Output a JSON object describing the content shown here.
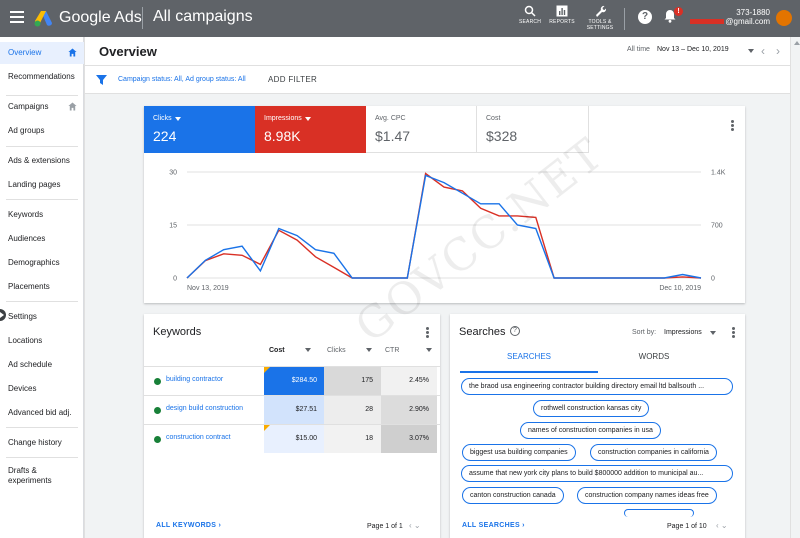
{
  "topbar": {
    "brand": "Google Ads",
    "title": "All campaigns",
    "tools": [
      {
        "label": "SEARCH",
        "icon": "search-icon"
      },
      {
        "label": "REPORTS",
        "icon": "reports-icon"
      },
      {
        "label1": "TOOLS &",
        "label2": "SETTINGS",
        "icon": "wrench-icon"
      }
    ],
    "notification_badge": "!",
    "account_number": "373-1880",
    "account_email": "@gmail.com"
  },
  "sidebar": {
    "items": [
      {
        "label": "Overview",
        "active": true
      },
      {
        "label": "Recommendations"
      },
      {
        "label": "Campaigns"
      },
      {
        "label": "Ad groups"
      },
      {
        "label": "Ads & extensions"
      },
      {
        "label": "Landing pages"
      },
      {
        "label": "Keywords"
      },
      {
        "label": "Audiences"
      },
      {
        "label": "Demographics"
      },
      {
        "label": "Placements"
      },
      {
        "label": "Settings"
      },
      {
        "label": "Locations"
      },
      {
        "label": "Ad schedule"
      },
      {
        "label": "Devices"
      },
      {
        "label": "Advanced bid adj."
      },
      {
        "label": "Change history"
      },
      {
        "label": "Drafts &"
      },
      {
        "label": "experiments"
      }
    ]
  },
  "header": {
    "title": "Overview",
    "date_label": "All time",
    "date_range": "Nov 13 – Dec 10, 2019"
  },
  "filter": {
    "status": "Campaign status: All, Ad group status: All",
    "add_filter": "ADD FILTER"
  },
  "metrics": [
    {
      "label": "Clicks",
      "value": "224",
      "color": "#1a73e8"
    },
    {
      "label": "Impressions",
      "value": "8.98K",
      "color": "#d93025"
    },
    {
      "label": "Avg. CPC",
      "value": "$1.47"
    },
    {
      "label": "Cost",
      "value": "$328"
    }
  ],
  "chart_data": {
    "type": "line",
    "x_start_label": "Nov 13, 2019",
    "x_end_label": "Dec 10, 2019",
    "left_axis_ticks": [
      "30",
      "15",
      "0"
    ],
    "right_axis_ticks": [
      "1.4K",
      "700",
      "0"
    ],
    "left_ylim": [
      0,
      30
    ],
    "right_ylim": [
      0,
      1400
    ],
    "series": [
      {
        "name": "Clicks",
        "color": "#1a73e8",
        "values": [
          0,
          5,
          8,
          9,
          2,
          14,
          12,
          8,
          7,
          0,
          0,
          0,
          0,
          29,
          27,
          24,
          21,
          21,
          15,
          14,
          0,
          0,
          0,
          0,
          0,
          0,
          0,
          1,
          0
        ]
      },
      {
        "name": "Impressions",
        "color": "#d93025",
        "values": [
          0,
          230,
          320,
          300,
          180,
          630,
          500,
          280,
          140,
          0,
          0,
          0,
          0,
          1380,
          1200,
          1150,
          920,
          820,
          820,
          800,
          0,
          0,
          0,
          0,
          0,
          0,
          0,
          15,
          0
        ]
      }
    ]
  },
  "keywords": {
    "title": "Keywords",
    "headers": {
      "cost": "Cost",
      "clicks": "Clicks",
      "ctr": "CTR"
    },
    "rows": [
      {
        "keyword": "building contractor",
        "cost": "$284.50",
        "clicks": "175",
        "ctr": "2.45%"
      },
      {
        "keyword": "design build construction",
        "cost": "$27.51",
        "clicks": "28",
        "ctr": "2.90%"
      },
      {
        "keyword": "construction contract",
        "cost": "$15.00",
        "clicks": "18",
        "ctr": "3.07%"
      }
    ],
    "footer_link": "ALL KEYWORDS",
    "pager": "Page 1 of 1"
  },
  "searches": {
    "title": "Searches",
    "sort_label": "Sort by:",
    "sort_value": "Impressions",
    "tabs": [
      "SEARCHES",
      "WORDS"
    ],
    "chips": [
      "the braod usa engineering contractor building directory email ltd ballsouth ...",
      "rothwell construction kansas city",
      "names of construction companies in usa",
      "biggest usa building companies",
      "construction companies in california",
      "assume that new york city plans to build $800000 addition to municipal au...",
      "canton construction canada",
      "construction company names ideas free"
    ],
    "footer_link": "ALL SEARCHES",
    "pager": "Page 1 of 10"
  },
  "watermark": "GOVCC.NET",
  "colors": {
    "topbar": "#5f6368",
    "accent": "#1a73e8",
    "impressions": "#d93025",
    "status_green": "#188038",
    "cost_highlight": "#1a73e8"
  }
}
